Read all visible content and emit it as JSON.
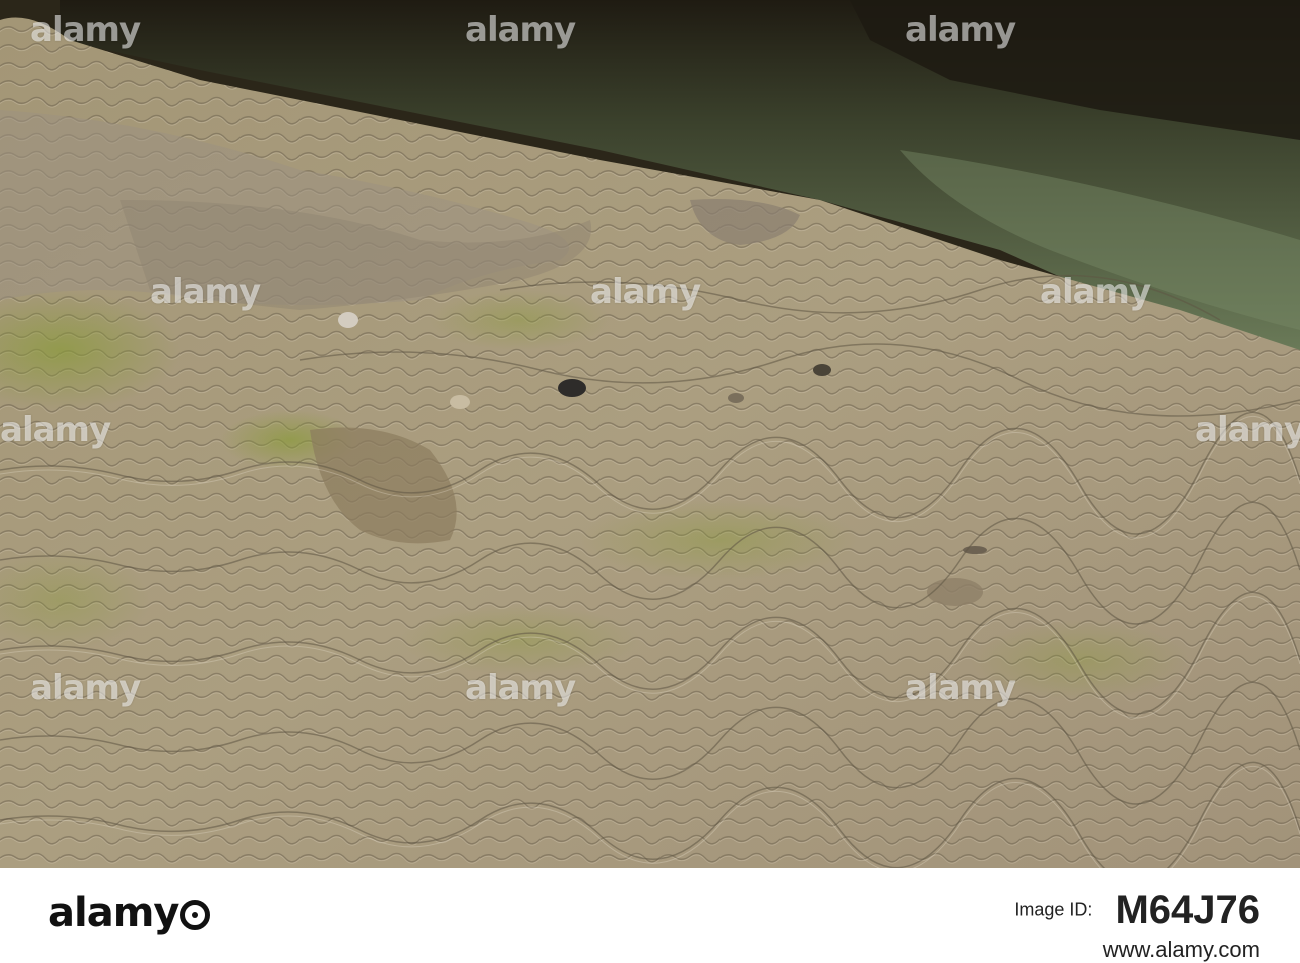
{
  "watermark": {
    "brand": "alamy"
  },
  "footer": {
    "logo": "alamy",
    "image_id_label": "Image ID:",
    "image_id": "M64J76",
    "site": "www.alamy.com"
  },
  "scene": {
    "description_colors": {
      "sinter": "#a89a7e",
      "algae": "#8fa04a",
      "water": "#3d4a32",
      "bank": "#2a2518"
    }
  }
}
